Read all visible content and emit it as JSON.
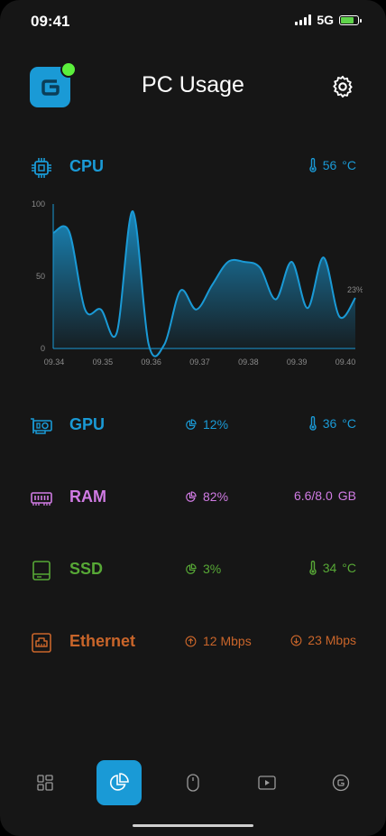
{
  "status": {
    "time": "09:41",
    "network": "5G",
    "battery_level": 0.85,
    "battery_color": "#5fd34a"
  },
  "header": {
    "title": "PC Usage",
    "online_indicator_color": "#5bf03c"
  },
  "colors": {
    "cpu": "#1a9ad6",
    "gpu": "#1a9ad6",
    "ram": "#d07be3",
    "ssd": "#57a836",
    "ethernet": "#c9652a"
  },
  "cpu": {
    "label": "CPU",
    "temp": "56",
    "temp_unit": "°C",
    "icon": "cpu-chip-icon"
  },
  "chart_data": {
    "type": "area",
    "x_ticks": [
      "09.34",
      "09.35",
      "09.36",
      "09.37",
      "09.38",
      "09.39",
      "09.40"
    ],
    "y_ticks": [
      "100",
      "50",
      "0"
    ],
    "ylim": [
      0,
      100
    ],
    "y_values": [
      80,
      81,
      27,
      27,
      11,
      95,
      3,
      3,
      40,
      27,
      44,
      60,
      60,
      56,
      34,
      60,
      28,
      63,
      22,
      35
    ],
    "last_label": "23%"
  },
  "gpu": {
    "label": "GPU",
    "usage": "12%",
    "temp": "36",
    "temp_unit": "°C",
    "icon": "graphics-card-icon"
  },
  "ram": {
    "label": "RAM",
    "usage": "82%",
    "amount": "6.6/8.0",
    "amount_unit": "GB",
    "icon": "memory-module-icon"
  },
  "ssd": {
    "label": "SSD",
    "usage": "3%",
    "temp": "34",
    "temp_unit": "°C",
    "icon": "drive-icon"
  },
  "ethernet": {
    "label": "Ethernet",
    "upload": "12 Mbps",
    "download": "23 Mbps",
    "icon": "ethernet-port-icon"
  },
  "nav": {
    "tabs": [
      {
        "name": "dashboard",
        "icon": "grid-icon"
      },
      {
        "name": "usage",
        "icon": "pie-chart-icon",
        "active": true
      },
      {
        "name": "mouse",
        "icon": "mouse-icon"
      },
      {
        "name": "media",
        "icon": "play-icon"
      },
      {
        "name": "account",
        "icon": "g-logo-icon"
      }
    ]
  }
}
